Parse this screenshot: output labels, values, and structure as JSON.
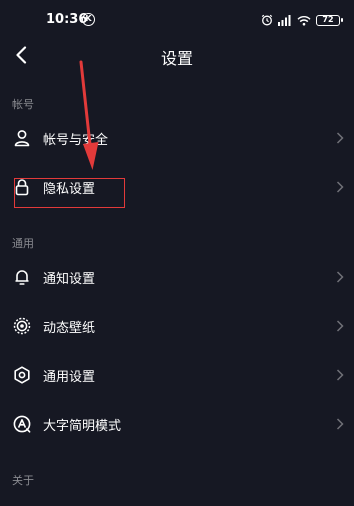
{
  "status": {
    "time": "10:36",
    "notif_glyph": "K",
    "battery": "72"
  },
  "header": {
    "title": "设置"
  },
  "sections": [
    {
      "label": "帐号",
      "items": [
        {
          "label": "帐号与安全",
          "icon": "person-icon"
        },
        {
          "label": "隐私设置",
          "icon": "lock-icon"
        }
      ]
    },
    {
      "label": "通用",
      "items": [
        {
          "label": "通知设置",
          "icon": "bell-icon"
        },
        {
          "label": "动态壁纸",
          "icon": "wallpaper-icon"
        },
        {
          "label": "通用设置",
          "icon": "gear-icon"
        },
        {
          "label": "大字简明模式",
          "icon": "large-text-icon"
        }
      ]
    },
    {
      "label": "关于",
      "items": []
    }
  ],
  "colors": {
    "background": "#161823",
    "text": "#ffffff",
    "section_label": "#8a8b91",
    "chevron": "#6f7077",
    "annotation": "#e23a3a"
  }
}
